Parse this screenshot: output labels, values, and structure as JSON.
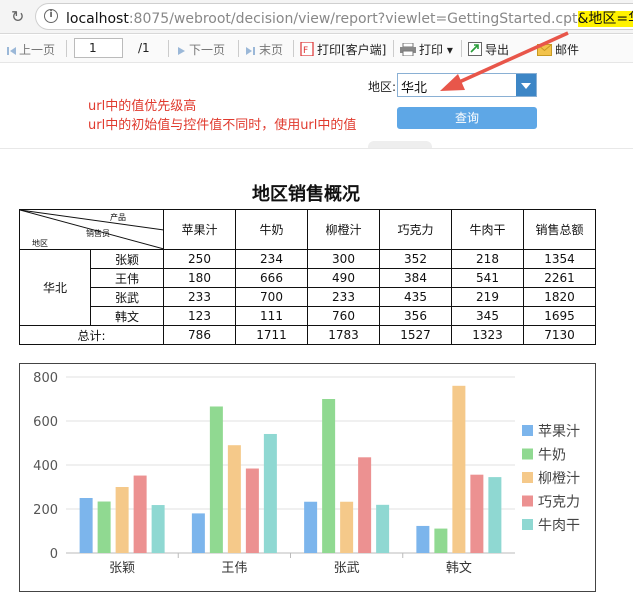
{
  "browser": {
    "info_glyph": "i",
    "url_host": "localhost",
    "url_rest": ":8075/webroot/decision/view/report?viewlet=GettingStarted.cpt",
    "url_highlight": "&地区=华北"
  },
  "toolbar": {
    "prev": "上一页",
    "page_value": "1",
    "total": "/1",
    "next": "下一页",
    "last": "末页",
    "print_client": "打印[客户端]",
    "print": "打印",
    "export": "导出",
    "mail": "邮件",
    "accent": "#4a8fd6"
  },
  "param": {
    "note1": "url中的值优先级高",
    "note2": "url中的初始值与控件值不同时，使用url中的值",
    "label": "地区:",
    "value": "华北",
    "query": "查询"
  },
  "report": {
    "title": "地区销售概况",
    "corner": {
      "top": "产品",
      "mid": "销售员",
      "bottom": "地区"
    },
    "columns": [
      "苹果汁",
      "牛奶",
      "柳橙汁",
      "巧克力",
      "牛肉干",
      "销售总额"
    ],
    "region": "华北",
    "rows": [
      {
        "name": "张颖",
        "vals": [
          "250",
          "234",
          "300",
          "352",
          "218",
          "1354"
        ]
      },
      {
        "name": "王伟",
        "vals": [
          "180",
          "666",
          "490",
          "384",
          "541",
          "2261"
        ]
      },
      {
        "name": "张武",
        "vals": [
          "233",
          "700",
          "233",
          "435",
          "219",
          "1820"
        ]
      },
      {
        "name": "韩文",
        "vals": [
          "123",
          "111",
          "760",
          "356",
          "345",
          "1695"
        ]
      }
    ],
    "total_label": "总计:",
    "totals": [
      "786",
      "1711",
      "1783",
      "1527",
      "1323",
      "7130"
    ]
  },
  "chart_data": {
    "type": "bar",
    "categories": [
      "张颖",
      "王伟",
      "张武",
      "韩文"
    ],
    "series": [
      {
        "name": "苹果汁",
        "values": [
          250,
          180,
          233,
          123
        ],
        "color": "#7cb5ec"
      },
      {
        "name": "牛奶",
        "values": [
          234,
          666,
          700,
          111
        ],
        "color": "#90d991"
      },
      {
        "name": "柳橙汁",
        "values": [
          300,
          490,
          233,
          760
        ],
        "color": "#f5c98a"
      },
      {
        "name": "巧克力",
        "values": [
          352,
          384,
          435,
          356
        ],
        "color": "#ec9191"
      },
      {
        "name": "牛肉干",
        "values": [
          218,
          541,
          219,
          345
        ],
        "color": "#8fd8d2"
      }
    ],
    "ylim": [
      0,
      800
    ],
    "yticks": [
      "0",
      "200",
      "400",
      "600",
      "800"
    ],
    "grid": true,
    "legend": "right"
  }
}
